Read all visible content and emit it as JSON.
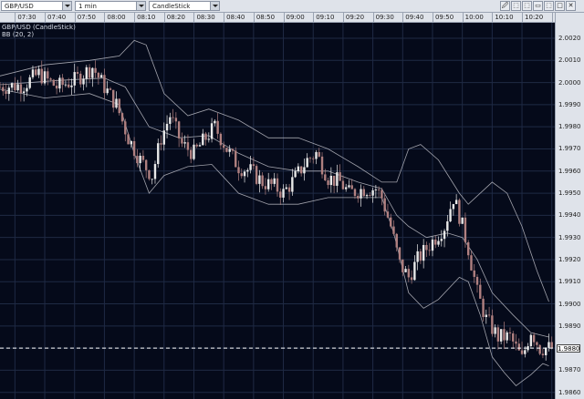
{
  "toolbar": {
    "symbol": "GBP/USD",
    "timeframe": "1 min",
    "chart_type": "CandleStick",
    "buttons": [
      "🖉",
      "⬚",
      "⬚",
      "▭",
      "⬚",
      "□",
      "✕"
    ]
  },
  "time_axis": [
    "07:30",
    "07:40",
    "07:50",
    "08:00",
    "08:10",
    "08:20",
    "08:30",
    "08:40",
    "08:50",
    "09:00",
    "09:10",
    "09:20",
    "09:30",
    "09:40",
    "09:50",
    "10:00",
    "10:10",
    "10:20",
    "10:30"
  ],
  "legend": {
    "series": "GBP/USD (CandleStick)",
    "indicator": "BB (20, 2)"
  },
  "price_axis": [
    "2.0020",
    "2.0010",
    "2.0000",
    "1.9990",
    "1.9980",
    "1.9970",
    "1.9960",
    "1.9950",
    "1.9940",
    "1.9930",
    "1.9920",
    "1.9910",
    "1.9900",
    "1.9890",
    "1.9880",
    "1.9870",
    "1.9860"
  ],
  "current_price": "1.9880",
  "colors": {
    "background": "#050a1a",
    "grid": "#1f2a44",
    "bull": "#e8e8e8",
    "bear": "#b08080",
    "band": "#c8c8d0",
    "price_line": "#ffffff"
  },
  "chart_data": {
    "type": "candlestick",
    "y_range": [
      1.9857,
      2.0027
    ],
    "x_range": [
      "07:25",
      "10:31"
    ],
    "close_path": [
      [
        "07:25",
        1.9998
      ],
      [
        "07:33",
        1.9999
      ],
      [
        "07:38",
        2.0004
      ],
      [
        "07:44",
        1.9998
      ],
      [
        "07:50",
        2.0001
      ],
      [
        "07:56",
        2.0007
      ],
      [
        "08:00",
        1.9998
      ],
      [
        "08:04",
        1.999
      ],
      [
        "08:08",
        1.9975
      ],
      [
        "08:12",
        1.9965
      ],
      [
        "08:16",
        1.9958
      ],
      [
        "08:19",
        1.9975
      ],
      [
        "08:22",
        1.9985
      ],
      [
        "08:26",
        1.9972
      ],
      [
        "08:30",
        1.9968
      ],
      [
        "08:34",
        1.9975
      ],
      [
        "08:37",
        1.998
      ],
      [
        "08:41",
        1.997
      ],
      [
        "08:45",
        1.9962
      ],
      [
        "08:49",
        1.996
      ],
      [
        "08:53",
        1.9955
      ],
      [
        "08:57",
        1.9953
      ],
      [
        "09:00",
        1.995
      ],
      [
        "09:04",
        1.9957
      ],
      [
        "09:08",
        1.9965
      ],
      [
        "09:11",
        1.9968
      ],
      [
        "09:15",
        1.9957
      ],
      [
        "09:19",
        1.9955
      ],
      [
        "09:22",
        1.995
      ],
      [
        "09:27",
        1.9952
      ],
      [
        "09:31",
        1.9952
      ],
      [
        "09:33",
        1.9948
      ],
      [
        "09:36",
        1.9935
      ],
      [
        "09:39",
        1.9918
      ],
      [
        "09:42",
        1.9912
      ],
      [
        "09:45",
        1.992
      ],
      [
        "09:48",
        1.9925
      ],
      [
        "09:51",
        1.993
      ],
      [
        "09:54",
        1.9935
      ],
      [
        "09:57",
        1.9948
      ],
      [
        "09:59",
        1.994
      ],
      [
        "10:02",
        1.9925
      ],
      [
        "10:05",
        1.9905
      ],
      [
        "10:08",
        1.9893
      ],
      [
        "10:12",
        1.9885
      ],
      [
        "10:16",
        1.9885
      ],
      [
        "10:20",
        1.9875
      ],
      [
        "10:23",
        1.9888
      ],
      [
        "10:26",
        1.988
      ],
      [
        "10:30",
        1.988
      ]
    ],
    "upper_band": [
      [
        "07:25",
        2.0003
      ],
      [
        "07:40",
        2.0008
      ],
      [
        "07:55",
        2.001
      ],
      [
        "08:05",
        2.0012
      ],
      [
        "08:10",
        2.0019
      ],
      [
        "08:14",
        2.0017
      ],
      [
        "08:20",
        1.9995
      ],
      [
        "08:28",
        1.9985
      ],
      [
        "08:35",
        1.9988
      ],
      [
        "08:45",
        1.9983
      ],
      [
        "08:55",
        1.9975
      ],
      [
        "09:05",
        1.9975
      ],
      [
        "09:15",
        1.997
      ],
      [
        "09:25",
        1.9962
      ],
      [
        "09:33",
        1.9955
      ],
      [
        "09:38",
        1.9955
      ],
      [
        "09:42",
        1.997
      ],
      [
        "09:46",
        1.9972
      ],
      [
        "09:52",
        1.9965
      ],
      [
        "09:59",
        1.995
      ],
      [
        "10:02",
        1.9945
      ],
      [
        "10:06",
        1.995
      ],
      [
        "10:10",
        1.9955
      ],
      [
        "10:15",
        1.995
      ],
      [
        "10:20",
        1.9935
      ],
      [
        "10:25",
        1.9915
      ],
      [
        "10:29",
        1.9901
      ]
    ],
    "lower_band": [
      [
        "07:25",
        1.9997
      ],
      [
        "07:40",
        1.9993
      ],
      [
        "07:55",
        1.9995
      ],
      [
        "08:05",
        1.999
      ],
      [
        "08:10",
        1.9968
      ],
      [
        "08:15",
        1.995
      ],
      [
        "08:20",
        1.9958
      ],
      [
        "08:28",
        1.9962
      ],
      [
        "08:36",
        1.9963
      ],
      [
        "08:45",
        1.995
      ],
      [
        "08:55",
        1.9945
      ],
      [
        "09:05",
        1.9945
      ],
      [
        "09:15",
        1.9948
      ],
      [
        "09:25",
        1.9948
      ],
      [
        "09:33",
        1.9948
      ],
      [
        "09:37",
        1.9932
      ],
      [
        "09:42",
        1.9905
      ],
      [
        "09:47",
        1.9898
      ],
      [
        "09:52",
        1.9902
      ],
      [
        "09:59",
        1.9912
      ],
      [
        "10:02",
        1.991
      ],
      [
        "10:06",
        1.9895
      ],
      [
        "10:10",
        1.9876
      ],
      [
        "10:14",
        1.9869
      ],
      [
        "10:18",
        1.9863
      ],
      [
        "10:23",
        1.9868
      ],
      [
        "10:27",
        1.9873
      ],
      [
        "10:29",
        1.9872
      ]
    ],
    "middle_band": [
      [
        "07:25",
        1.9999
      ],
      [
        "07:45",
        2.0001
      ],
      [
        "08:00",
        2.0002
      ],
      [
        "08:07",
        1.9998
      ],
      [
        "08:15",
        1.998
      ],
      [
        "08:25",
        1.9975
      ],
      [
        "08:35",
        1.9976
      ],
      [
        "08:45",
        1.9968
      ],
      [
        "08:55",
        1.9962
      ],
      [
        "09:05",
        1.996
      ],
      [
        "09:15",
        1.996
      ],
      [
        "09:25",
        1.9955
      ],
      [
        "09:33",
        1.9952
      ],
      [
        "09:38",
        1.994
      ],
      [
        "09:42",
        1.9935
      ],
      [
        "09:48",
        1.993
      ],
      [
        "09:55",
        1.9932
      ],
      [
        "10:00",
        1.993
      ],
      [
        "10:05",
        1.992
      ],
      [
        "10:10",
        1.9905
      ],
      [
        "10:17",
        1.9895
      ],
      [
        "10:23",
        1.9887
      ],
      [
        "10:29",
        1.9885
      ]
    ]
  }
}
